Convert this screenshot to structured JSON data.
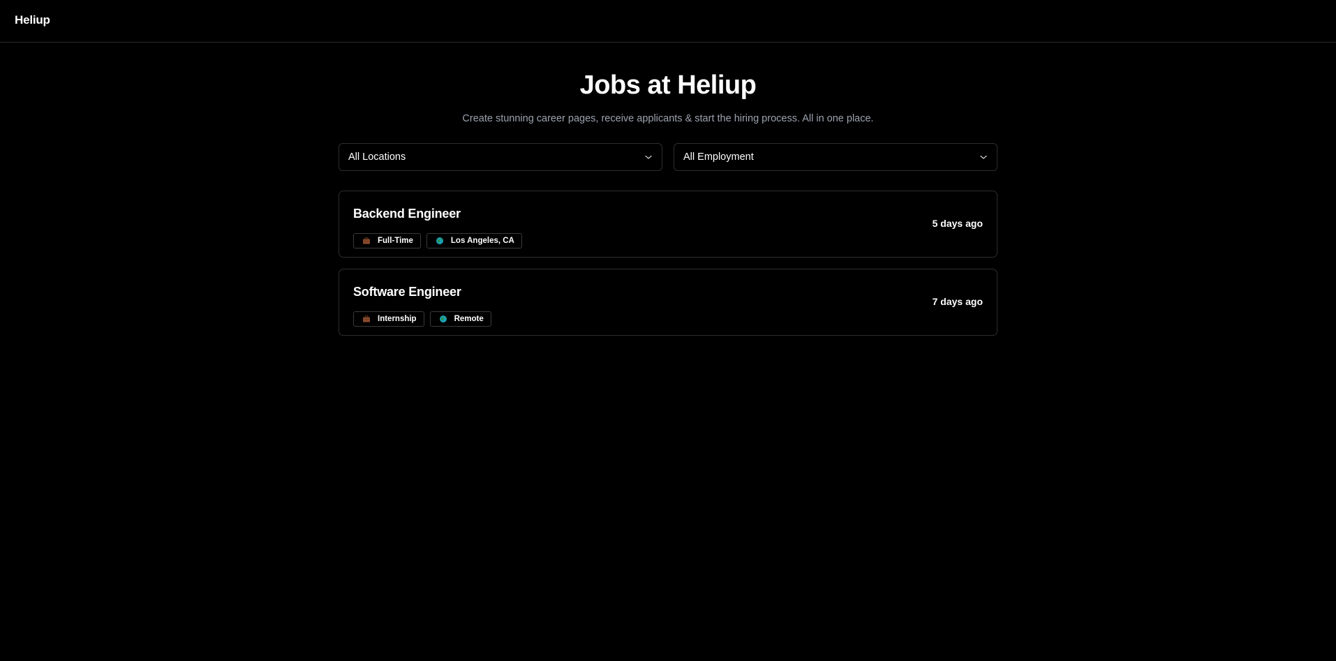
{
  "header": {
    "brand": "Heliup"
  },
  "hero": {
    "title": "Jobs at Heliup",
    "subtitle": "Create stunning career pages, receive applicants & start the hiring process. All in one place."
  },
  "filters": {
    "location": "All Locations",
    "employment": "All Employment"
  },
  "jobs": [
    {
      "title": "Backend Engineer",
      "employment_type": "Full-Time",
      "location": "Los Angeles, CA",
      "posted": "5 days ago"
    },
    {
      "title": "Software Engineer",
      "employment_type": "Internship",
      "location": "Remote",
      "posted": "7 days ago"
    }
  ],
  "icons": {
    "briefcase": "briefcase-icon",
    "globe": "globe-icon",
    "chevron": "chevron-down-icon"
  },
  "colors": {
    "background": "#000000",
    "border": "#2e2e2e",
    "subtitle": "#9ca3af",
    "briefcase": "#8b4a2b",
    "globe": "#1aa3b8"
  }
}
